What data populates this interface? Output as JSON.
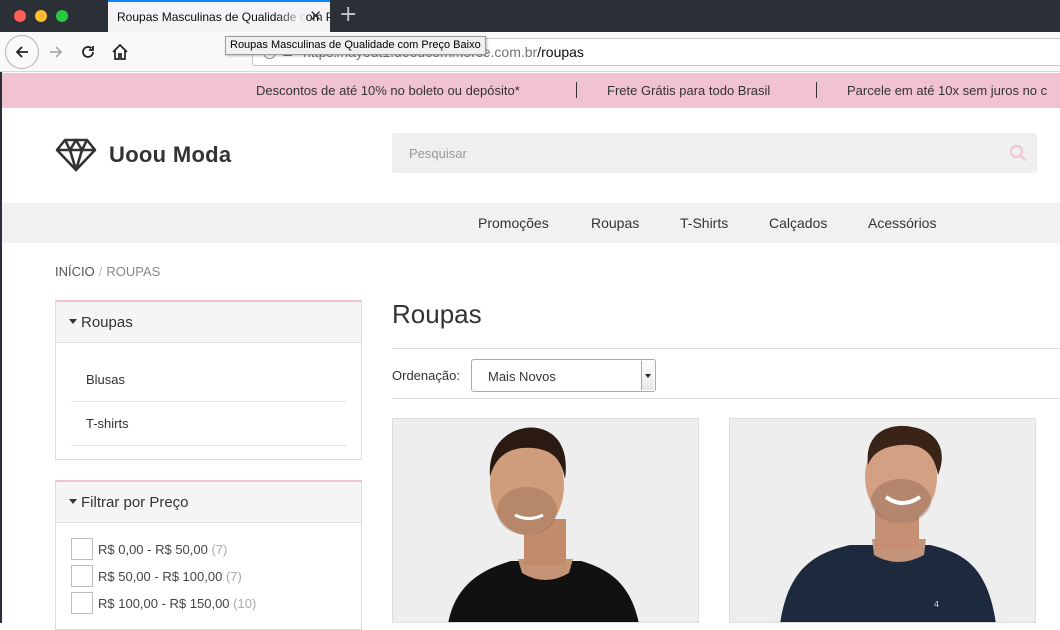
{
  "browser": {
    "tab_title": "Roupas Masculinas de Qualidade com Preço Baixo",
    "tooltip": "Roupas Masculinas de Qualidade com Preço Baixo",
    "url_prefix": "https://layout1.uooucommerce.com.br",
    "url_path": "/roupas",
    "new_tab_symbol": "+",
    "close_symbol": "✕"
  },
  "promo_bar": {
    "items": [
      "Descontos de até 10% no boleto ou depósito*",
      "Frete Grátis para todo Brasil",
      "Parcele em até 10x sem juros no c"
    ],
    "color": "#f1c2d0"
  },
  "header": {
    "logo_text": "Uoou Moda",
    "logo_icon": "diamond-icon",
    "search_placeholder": "Pesquisar",
    "search_icon": "search-icon"
  },
  "menu": [
    "Promoções",
    "Roupas",
    "T-Shirts",
    "Calçados",
    "Acessórios"
  ],
  "breadcrumb": {
    "home": "INÍCIO",
    "separator": "/",
    "current": "ROUPAS"
  },
  "sidebar": {
    "categories": {
      "title": "Roupas",
      "items": [
        "Blusas",
        "T-shirts"
      ]
    },
    "price_filter": {
      "title": "Filtrar por Preço",
      "ranges": [
        {
          "label": "R$ 0,00 - R$ 50,00",
          "count": "(7)"
        },
        {
          "label": "R$ 50,00 - R$ 100,00",
          "count": "(7)"
        },
        {
          "label": "R$ 100,00 - R$ 150,00",
          "count": "(10)"
        }
      ]
    }
  },
  "main": {
    "title": "Roupas",
    "sort_label": "Ordenação:",
    "sort_value": "Mais Novos",
    "product_2_shirt_mark": "4"
  }
}
